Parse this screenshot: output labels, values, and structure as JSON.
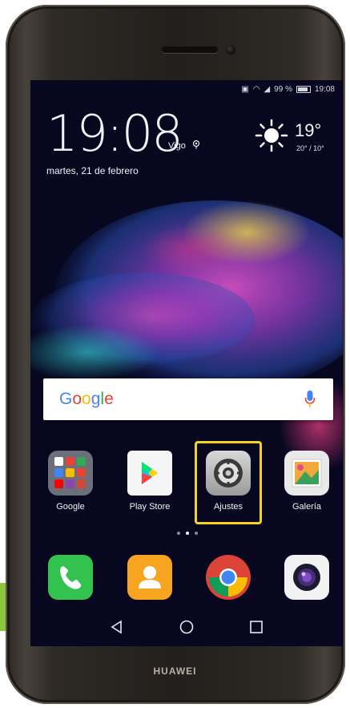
{
  "status_bar": {
    "battery_percent": "99 %",
    "time": "19:08"
  },
  "clock_widget": {
    "time": "19:08",
    "city": "Vigo",
    "date": "martes, 21 de febrero",
    "temperature": "19°",
    "temp_range": "20° / 10°"
  },
  "search": {
    "logo_text": "Google"
  },
  "apps": [
    {
      "label": "Google"
    },
    {
      "label": "Play Store"
    },
    {
      "label": "Ajustes"
    },
    {
      "label": "Galería"
    }
  ],
  "dock": [
    "phone-icon",
    "contacts-icon",
    "chrome-icon",
    "camera-icon"
  ],
  "brand": "HUAWEI",
  "colors": {
    "highlight": "#f4d21f",
    "screen_bg": "#070720"
  }
}
